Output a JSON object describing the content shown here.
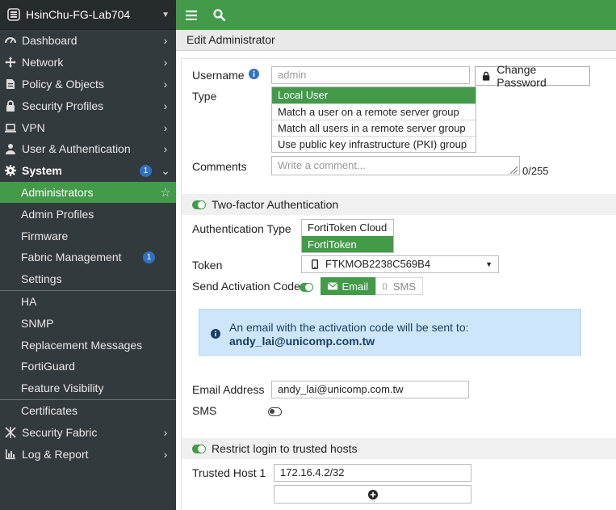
{
  "sidebar": {
    "device_name": "HsinChu-FG-Lab704",
    "items": [
      {
        "label": "Dashboard"
      },
      {
        "label": "Network"
      },
      {
        "label": "Policy & Objects"
      },
      {
        "label": "Security Profiles"
      },
      {
        "label": "VPN"
      },
      {
        "label": "User & Authentication"
      },
      {
        "label": "System",
        "badge": "1"
      },
      {
        "label": "Administrators"
      },
      {
        "label": "Admin Profiles"
      },
      {
        "label": "Firmware"
      },
      {
        "label": "Fabric Management",
        "badge": "1"
      },
      {
        "label": "Settings"
      },
      {
        "label": "HA"
      },
      {
        "label": "SNMP"
      },
      {
        "label": "Replacement Messages"
      },
      {
        "label": "FortiGuard"
      },
      {
        "label": "Feature Visibility"
      },
      {
        "label": "Certificates"
      },
      {
        "label": "Security Fabric"
      },
      {
        "label": "Log & Report"
      }
    ]
  },
  "page": {
    "title": "Edit Administrator"
  },
  "form": {
    "username_label": "Username",
    "username_placeholder": "admin",
    "change_password_label": "Change Password",
    "type_label": "Type",
    "type_options": [
      "Local User",
      "Match a user on a remote server group",
      "Match all users in a remote server group",
      "Use public key infrastructure (PKI) group"
    ],
    "comments_label": "Comments",
    "comments_placeholder": "Write a comment...",
    "comments_counter": "0/255",
    "two_factor": {
      "section_label": "Two-factor Authentication",
      "enabled": true,
      "auth_type_label": "Authentication Type",
      "auth_type_options": [
        "FortiToken Cloud",
        "FortiToken"
      ],
      "token_label": "Token",
      "token_value": "FTKMOB2238C569B4",
      "send_code_label": "Send Activation Code",
      "send_email_label": "Email",
      "send_sms_label": "SMS",
      "info_line1": "An email with the activation code will be sent to:",
      "info_email": "andy_lai@unicomp.com.tw",
      "email_address_label": "Email Address",
      "email_address_value": "andy_lai@unicomp.com.tw",
      "sms_label": "SMS"
    },
    "restrict": {
      "section_label": "Restrict login to trusted hosts",
      "trusted_host_label": "Trusted Host 1",
      "trusted_host_value": "172.16.4.2/32"
    }
  },
  "colors": {
    "accent": "#439b4a",
    "sidebar": "#333a3e",
    "badge": "#2f72c4",
    "info": "#cde6fb"
  }
}
